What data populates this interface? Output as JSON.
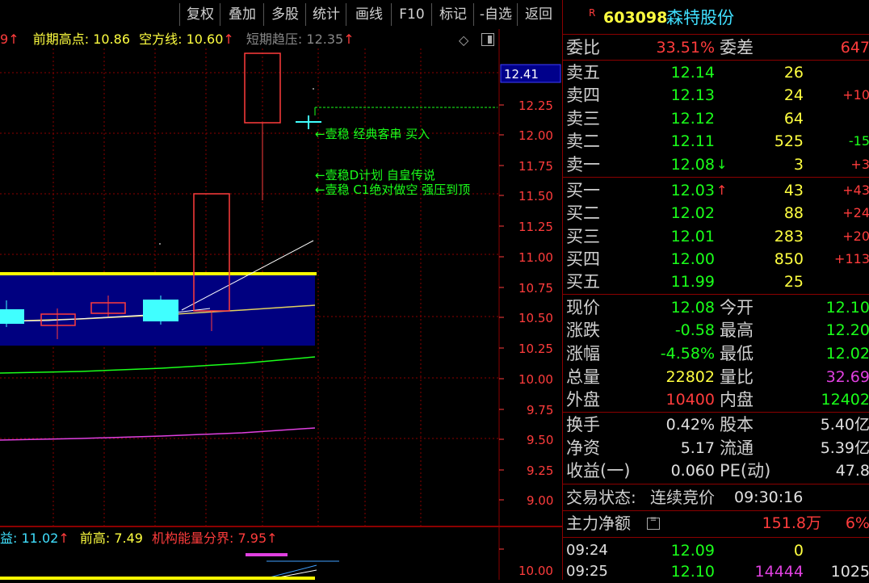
{
  "toolbar": {
    "buttons": [
      "复权",
      "叠加",
      "多股",
      "统计",
      "画线",
      "F10",
      "标记",
      "-自选",
      "返回"
    ]
  },
  "chart": {
    "info": {
      "lead_digit": "9",
      "prev_high_label": "前期高点:",
      "prev_high_value": "10.86",
      "bear_line_label": "空方线:",
      "bear_line_value": "10.60",
      "short_pressure_label": "短期趋压:",
      "short_pressure_value": "12.35"
    },
    "current_price_tag": "12.41",
    "price_ticks": [
      "12.25",
      "12.00",
      "11.75",
      "11.50",
      "11.25",
      "11.00",
      "10.75",
      "10.50",
      "10.25",
      "10.00",
      "9.75",
      "9.50",
      "9.25",
      "9.00"
    ],
    "annotations": [
      "←壹稳 经典客串 买入",
      "←壹稳D计划 自皇传说",
      "←壹稳 C1绝对做空 强压到顶"
    ],
    "lower_info": {
      "first_label_tail": "益:",
      "first_value": "11.02",
      "prev_high_label": "前高:",
      "prev_high_value": "7.49",
      "inst_label": "机构能量分界:",
      "inst_value": "7.95"
    },
    "lower_tick": "10.00",
    "colors": {
      "up": "#ff3c3c",
      "down": "#40ffff",
      "zone": "#000080",
      "band": "#ffff00",
      "ma_green": "#1aff1a",
      "ma_magenta": "#e040e0"
    }
  },
  "stock": {
    "marker": "R",
    "code": "603098",
    "name": "森特股份"
  },
  "quote": {
    "weibi_label": "委比",
    "weibi_value": "33.51%",
    "weicha_label": "委差",
    "weicha_value": "647",
    "asks": [
      {
        "label": "卖五",
        "price": "12.14",
        "vol": "26",
        "chg": ""
      },
      {
        "label": "卖四",
        "price": "12.13",
        "vol": "24",
        "chg": "+10"
      },
      {
        "label": "卖三",
        "price": "12.12",
        "vol": "64",
        "chg": ""
      },
      {
        "label": "卖二",
        "price": "12.11",
        "vol": "525",
        "chg": "-15"
      },
      {
        "label": "卖一",
        "price": "12.08",
        "vol": "3",
        "chg": "+3"
      }
    ],
    "bids": [
      {
        "label": "买一",
        "price": "12.03",
        "vol": "43",
        "chg": "+43"
      },
      {
        "label": "买二",
        "price": "12.02",
        "vol": "88",
        "chg": "+24"
      },
      {
        "label": "买三",
        "price": "12.01",
        "vol": "283",
        "chg": "+20"
      },
      {
        "label": "买四",
        "price": "12.00",
        "vol": "850",
        "chg": "+113"
      },
      {
        "label": "买五",
        "price": "11.99",
        "vol": "25",
        "chg": ""
      }
    ],
    "arrow_down": "↓",
    "arrow_up": "↑",
    "stats": {
      "xianjia_label": "现价",
      "xianjia": "12.08",
      "jinkai_label": "今开",
      "jinkai": "12.10",
      "zhangdie_label": "涨跌",
      "zhangdie": "-0.58",
      "zuigao_label": "最高",
      "zuigao": "12.20",
      "zhangfu_label": "涨幅",
      "zhangfu": "-4.58%",
      "zuidi_label": "最低",
      "zuidi": "12.02",
      "zongliang_label": "总量",
      "zongliang": "22802",
      "liangbi_label": "量比",
      "liangbi": "32.69",
      "waipan_label": "外盘",
      "waipan": "10400",
      "neipan_label": "内盘",
      "neipan": "12402",
      "huanshou_label": "换手",
      "huanshou": "0.42%",
      "guben_label": "股本",
      "guben": "5.40亿",
      "jingzi_label": "净资",
      "jingzi": "5.17",
      "liutong_label": "流通",
      "liutong": "5.39亿",
      "shouyi_label": "收益(一)",
      "shouyi": "0.060",
      "pe_label": "PE(动)",
      "pe": "47.8"
    },
    "trade_status_label": "交易状态:",
    "trade_status": "连续竞价",
    "trade_time": "09:30:16",
    "main_net_label": "主力净额",
    "main_net_value": "151.8万",
    "main_net_pct": "6%",
    "ticks": [
      {
        "time": "09:24",
        "price": "12.09",
        "vol": "0",
        "extra": ""
      },
      {
        "time": "09:25",
        "price": "12.10",
        "vol": "14444",
        "extra": "1025"
      }
    ]
  }
}
